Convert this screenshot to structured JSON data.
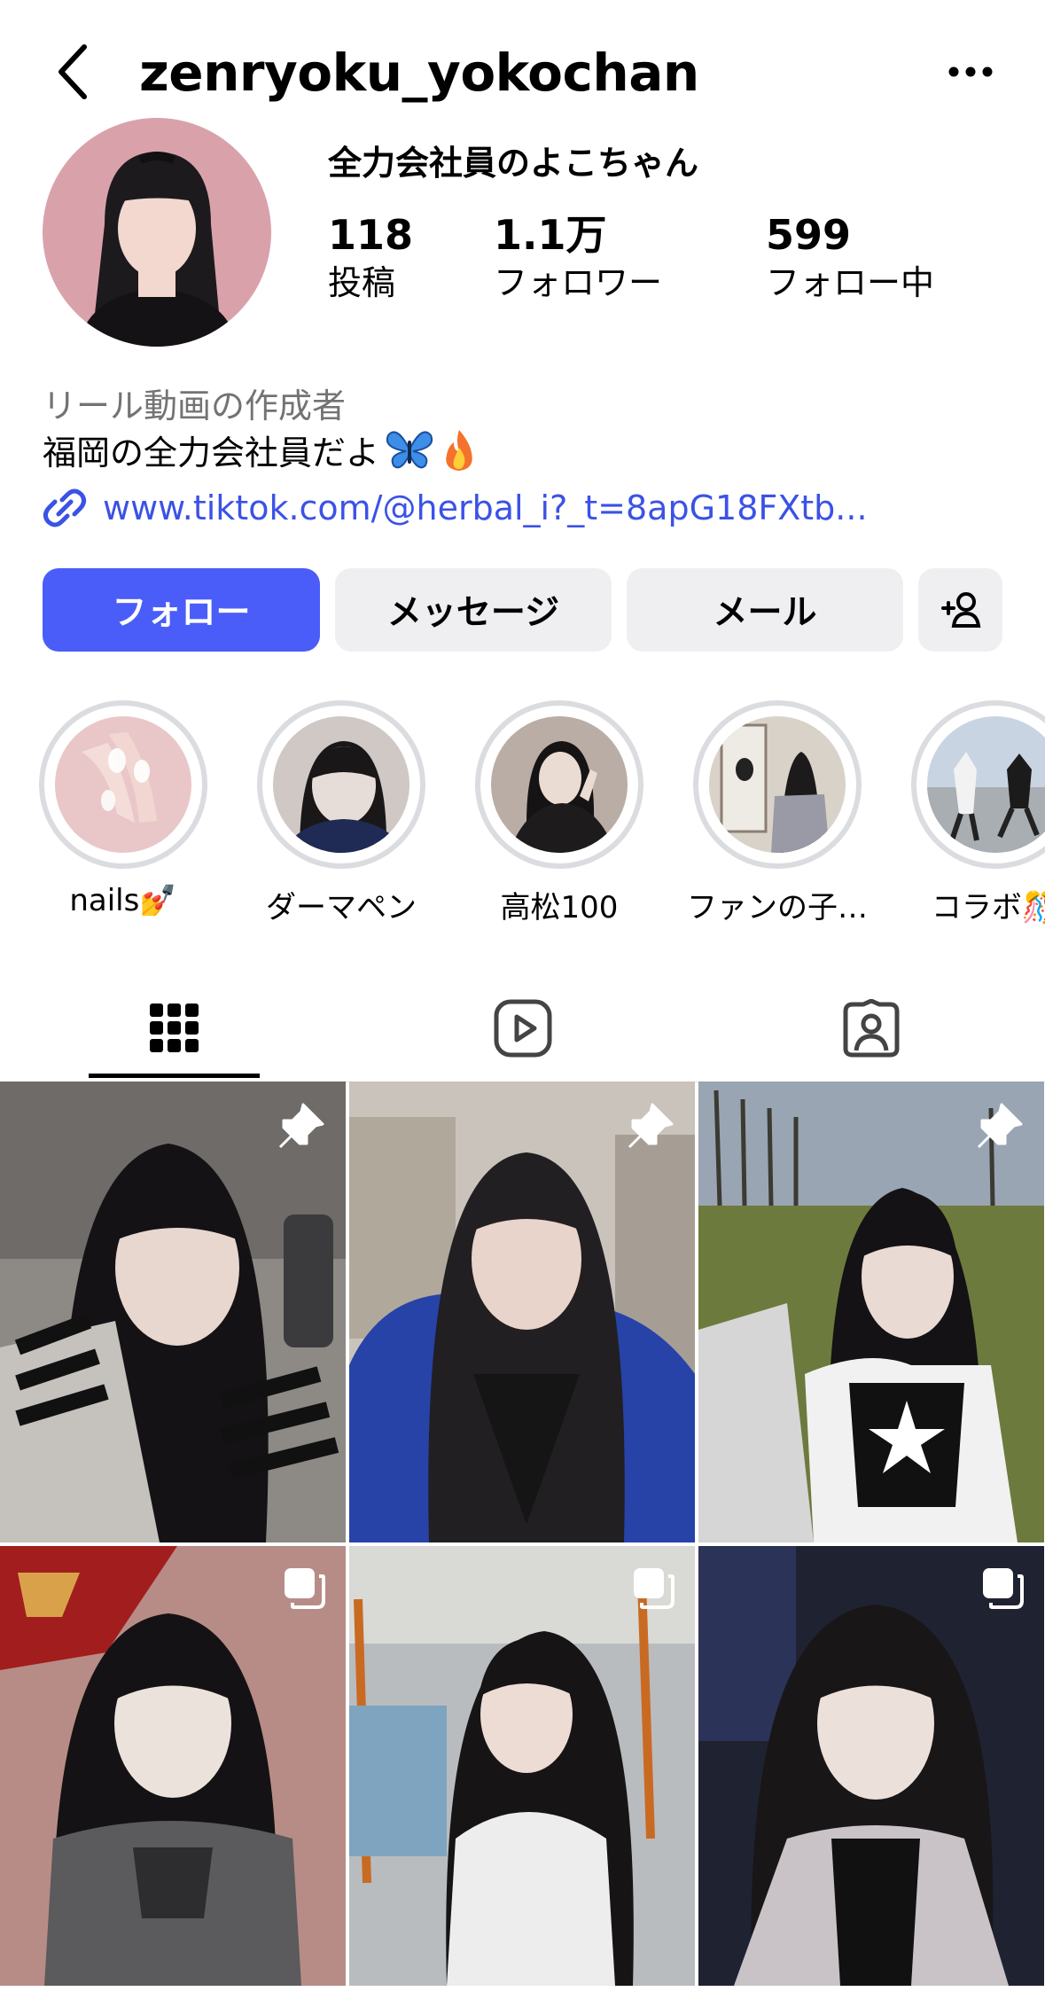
{
  "header": {
    "username": "zenryoku_yokochan",
    "back_icon": "chevron-left-icon",
    "more_icon": "ellipsis-icon"
  },
  "profile": {
    "display_name": "全力会社員のよこちゃん",
    "stats": [
      {
        "value": "118",
        "label": "投稿"
      },
      {
        "value": "1.1万",
        "label": "フォロワー"
      },
      {
        "value": "599",
        "label": "フォロー中"
      }
    ],
    "category": "リール動画の作成者",
    "bio": "福岡の全力会社員だよ",
    "bio_emojis": [
      "butterfly",
      "fire"
    ],
    "link": "www.tiktok.com/@herbal_i?_t=8apG18FXtb..."
  },
  "actions": {
    "follow": "フォロー",
    "message": "メッセージ",
    "mail": "メール",
    "add_user_icon": "add-person-icon"
  },
  "highlights": [
    {
      "label": "nails💅"
    },
    {
      "label": "ダーマペン"
    },
    {
      "label": "高松100"
    },
    {
      "label": "ファンの子…"
    },
    {
      "label": "コラボ🎊"
    }
  ],
  "tabs": {
    "active": "grid",
    "icons": [
      "grid-icon",
      "reels-icon",
      "tagged-icon"
    ]
  },
  "grid": {
    "posts": [
      {
        "badge": "pin-icon"
      },
      {
        "badge": "pin-icon"
      },
      {
        "badge": "pin-icon"
      },
      {
        "badge": "carousel-icon"
      },
      {
        "badge": "carousel-icon"
      },
      {
        "badge": "carousel-icon"
      }
    ]
  },
  "colors": {
    "accent": "#4a5df9",
    "link": "#3b52e6",
    "secondary_text": "#737373",
    "button_bg": "#efeff1"
  }
}
